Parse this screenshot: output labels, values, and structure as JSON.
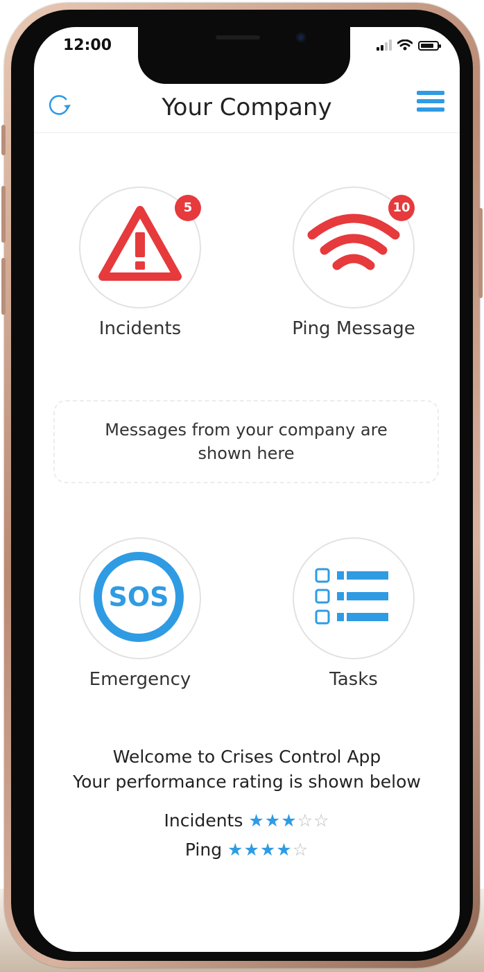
{
  "status_bar": {
    "time": "12:00"
  },
  "header": {
    "title": "Your Company",
    "refresh_icon": "refresh-icon",
    "menu_icon": "hamburger-menu-icon"
  },
  "tiles": [
    {
      "label": "Incidents",
      "badge": "5",
      "icon": "warning-triangle-icon",
      "color": "#e63a3c"
    },
    {
      "label": "Ping Message",
      "badge": "10",
      "icon": "wifi-signal-icon",
      "color": "#e63a3c"
    },
    {
      "label": "Emergency",
      "badge": null,
      "icon": "sos-icon",
      "color": "#2f9be3"
    },
    {
      "label": "Tasks",
      "badge": null,
      "icon": "task-list-icon",
      "color": "#2f9be3"
    }
  ],
  "message_box": {
    "text": "Messages from your company are shown here"
  },
  "welcome": {
    "line1": "Welcome to Crises Control App",
    "line2": "Your performance rating is shown below"
  },
  "ratings": [
    {
      "label": "Incidents",
      "stars": 3,
      "max": 5
    },
    {
      "label": "Ping",
      "stars": 4,
      "max": 5
    }
  ],
  "colors": {
    "accent": "#2f9be3",
    "alert": "#e63a3c"
  }
}
